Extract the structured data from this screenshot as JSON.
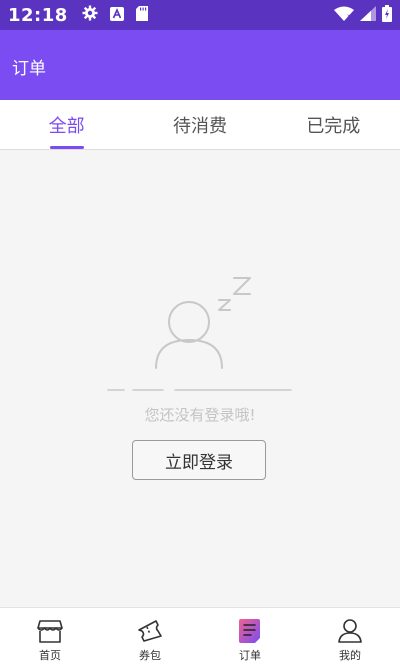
{
  "status_bar": {
    "time": "12:18",
    "icons": [
      "settings-icon",
      "text-a-icon",
      "sd-card-icon",
      "wifi-icon",
      "signal-icon",
      "battery-charging-icon"
    ]
  },
  "app_bar": {
    "title": "订单"
  },
  "tabs": [
    {
      "label": "全部",
      "active": true
    },
    {
      "label": "待消费",
      "active": false
    },
    {
      "label": "已完成",
      "active": false
    }
  ],
  "empty_state": {
    "message": "您还没有登录哦!",
    "login_button": "立即登录",
    "icon": "sleeping-user-icon"
  },
  "bottom_nav": [
    {
      "label": "首页",
      "icon": "store-icon",
      "active": false
    },
    {
      "label": "券包",
      "icon": "ticket-icon",
      "active": false
    },
    {
      "label": "订单",
      "icon": "order-doc-icon",
      "active": true
    },
    {
      "label": "我的",
      "icon": "profile-icon",
      "active": false
    }
  ],
  "colors": {
    "status_bar": "#5a33c0",
    "app_bar": "#7b4cf2",
    "accent": "#7b4cf2",
    "order_icon_gradient_start": "#f06292",
    "order_icon_gradient_end": "#7b4cf2"
  }
}
